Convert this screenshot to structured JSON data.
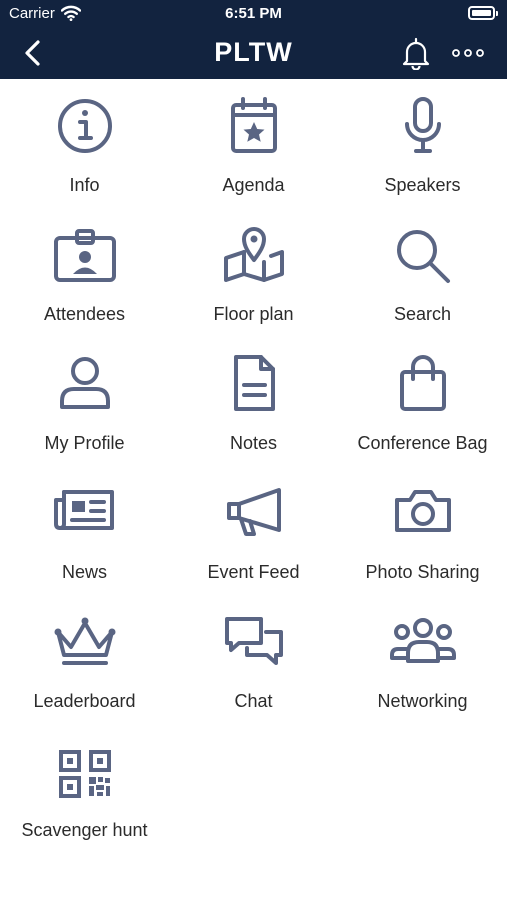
{
  "status_bar": {
    "carrier": "Carrier",
    "time": "6:51 PM"
  },
  "nav": {
    "title": "PLTW",
    "back_icon": "chevron-left-icon",
    "bell_icon": "bell-icon",
    "more_icon": "ellipsis-icon"
  },
  "colors": {
    "header_bg": "#12233f",
    "icon": "#5a6583",
    "label": "#2b2b2b"
  },
  "tiles": [
    {
      "label": "Info",
      "icon": "info-icon"
    },
    {
      "label": "Agenda",
      "icon": "calendar-star-icon"
    },
    {
      "label": "Speakers",
      "icon": "microphone-icon"
    },
    {
      "label": "Attendees",
      "icon": "id-badge-icon"
    },
    {
      "label": "Floor plan",
      "icon": "map-pin-icon"
    },
    {
      "label": "Search",
      "icon": "search-icon"
    },
    {
      "label": "My Profile",
      "icon": "user-icon"
    },
    {
      "label": "Notes",
      "icon": "document-icon"
    },
    {
      "label": "Conference Bag",
      "icon": "shopping-bag-icon"
    },
    {
      "label": "News",
      "icon": "newspaper-icon"
    },
    {
      "label": "Event Feed",
      "icon": "megaphone-icon"
    },
    {
      "label": "Photo Sharing",
      "icon": "camera-icon"
    },
    {
      "label": "Leaderboard",
      "icon": "crown-icon"
    },
    {
      "label": "Chat",
      "icon": "chat-bubbles-icon"
    },
    {
      "label": "Networking",
      "icon": "group-icon"
    },
    {
      "label": "Scavenger hunt",
      "icon": "qr-code-icon"
    }
  ]
}
